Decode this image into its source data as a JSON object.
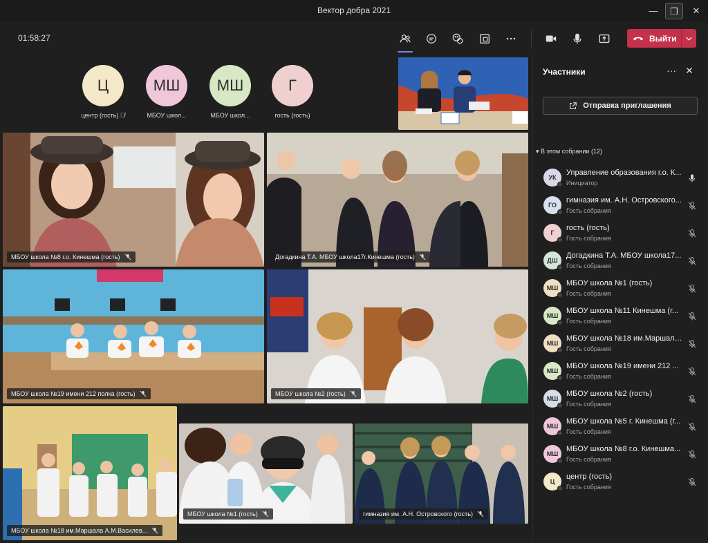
{
  "window": {
    "title": "Вектор добра 2021"
  },
  "toolbar": {
    "timer": "01:58:27",
    "leave_label": "Выйти"
  },
  "stage": {
    "top_avatars": [
      {
        "initials": "Ц",
        "name": "центр (гость)",
        "color": "#f3e9c8"
      },
      {
        "initials": "МШ",
        "name": "МБОУ школ...",
        "color": "#efc7d8"
      },
      {
        "initials": "МШ",
        "name": "МБОУ школ...",
        "color": "#d9e8c4"
      },
      {
        "initials": "Г",
        "name": "гость (гость)",
        "color": "#efcfcf"
      }
    ],
    "tiles": [
      {
        "label": "МБОУ школа №8 г.о. Кинешма (гость)"
      },
      {
        "label": "Догадкина Т.А. МБОУ школа17г.Кинешма (гость)"
      },
      {
        "label": "МБОУ школа №19 имени 212 полка (гость)"
      },
      {
        "label": "МБОУ школа №2 (гость)"
      },
      {
        "label": "МБОУ школа №18 им.Маршала А.М.Василев..."
      },
      {
        "label": "МБОУ школа №1 (гость)"
      },
      {
        "label": "гимназия им. А.Н. Островского (гость)"
      }
    ]
  },
  "panel": {
    "title": "Участники",
    "invite_label": "Отправка приглашения",
    "section_title": "В этом собрании (12)",
    "participants": [
      {
        "initials": "УК",
        "name": "Управление образования г.о. К...",
        "role": "Инициатор",
        "color": "#d7d7e8",
        "mic": "on"
      },
      {
        "initials": "ГО",
        "name": "гимназия им. А.Н. Островского...",
        "role": "Гость собрания",
        "color": "#d5e2ee",
        "mic": "off"
      },
      {
        "initials": "Г",
        "name": "гость (гость)",
        "role": "Гость собрания",
        "color": "#efcfcf",
        "mic": "off"
      },
      {
        "initials": "ДШ",
        "name": "Догадкина Т.А. МБОУ школа17...",
        "role": "Гость собрания",
        "color": "#d3e6d8",
        "mic": "off"
      },
      {
        "initials": "МШ",
        "name": "МБОУ школа №1 (гость)",
        "role": "Гость собрания",
        "color": "#f0dfc2",
        "mic": "off"
      },
      {
        "initials": "МШ",
        "name": "МБОУ школа №11 Кинешма (г...",
        "role": "Гость собрания",
        "color": "#d9e8c4",
        "mic": "off"
      },
      {
        "initials": "МШ",
        "name": "МБОУ школа №18 им.Маршала...",
        "role": "Гость собрания",
        "color": "#f0dfc2",
        "mic": "off"
      },
      {
        "initials": "МШ",
        "name": "МБОУ школа №19 имени 212 ...",
        "role": "Гость собрания",
        "color": "#d9e8c4",
        "mic": "off"
      },
      {
        "initials": "МШ",
        "name": "МБОУ школа №2 (гость)",
        "role": "Гость собрания",
        "color": "#d5dde8",
        "mic": "off"
      },
      {
        "initials": "МШ",
        "name": "МБОУ школа №5 г. Кинешма (г...",
        "role": "Гость собрания",
        "color": "#efc7d8",
        "mic": "off"
      },
      {
        "initials": "МШ",
        "name": "МБОУ школа №8 г.о. Кинешма...",
        "role": "Гость собрания",
        "color": "#efc7d8",
        "mic": "off"
      },
      {
        "initials": "Ц",
        "name": "центр (гость)",
        "role": "Гость собрания",
        "color": "#f3e9c8",
        "mic": "off"
      }
    ]
  }
}
